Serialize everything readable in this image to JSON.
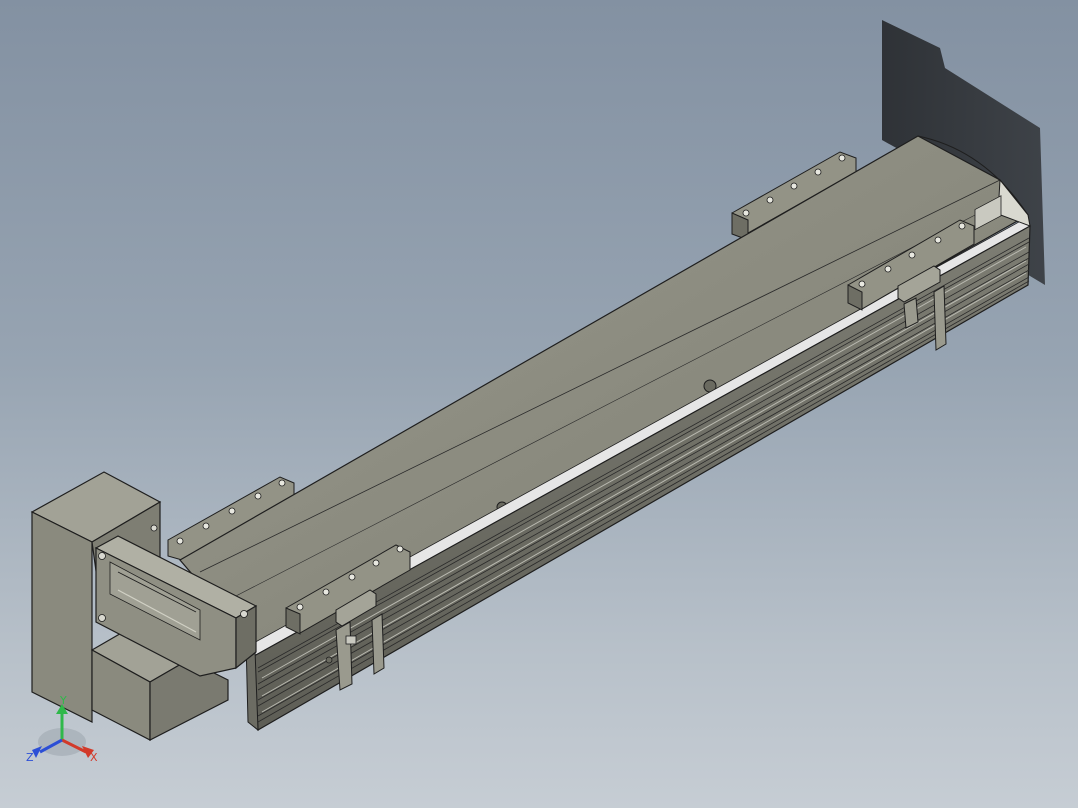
{
  "viewport": {
    "background_top": "#8391a2",
    "background_bottom": "#c6cdd4"
  },
  "model": {
    "body_color": "#8c8c80",
    "edge_color": "#1e1e1e",
    "rail_color": "#d8d8d8",
    "shadow_color": "#2c2f33"
  },
  "triad": {
    "x_label": "X",
    "y_label": "Y",
    "z_label": "Z",
    "x_color": "#d23a2a",
    "y_color": "#2fb84a",
    "z_color": "#2c4fd6"
  }
}
